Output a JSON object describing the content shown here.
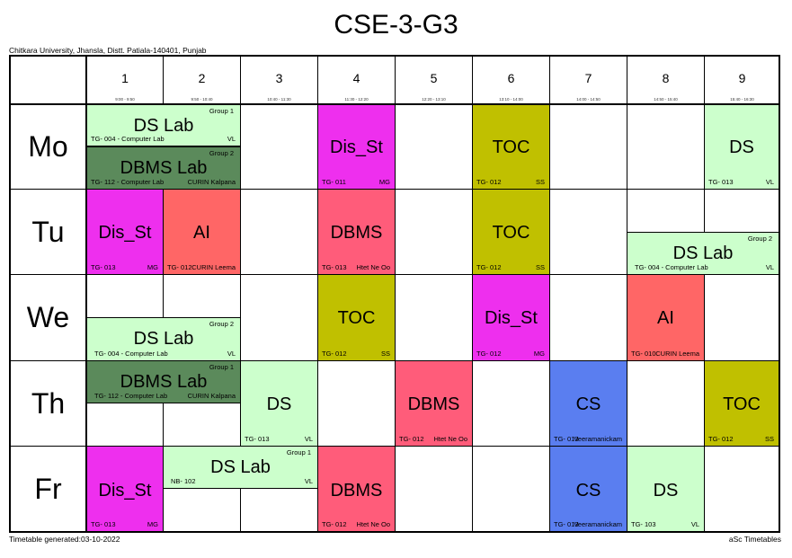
{
  "title": "CSE-3-G3",
  "school": "Chitkara University, Jhansla, Distt. Patiala-140401, Punjab",
  "footer": {
    "generated": "Timetable generated:03-10-2022",
    "brand": "aSc Timetables"
  },
  "periods": [
    {
      "num": "1",
      "time": "9:00 - 9:50"
    },
    {
      "num": "2",
      "time": "9:50 - 10:40"
    },
    {
      "num": "3",
      "time": "10:40 - 11:30"
    },
    {
      "num": "4",
      "time": "11:30 - 12:20"
    },
    {
      "num": "5",
      "time": "12:20 - 13:10"
    },
    {
      "num": "6",
      "time": "13:10 - 14:00"
    },
    {
      "num": "7",
      "time": "14:00 - 14:50"
    },
    {
      "num": "8",
      "time": "14:50 - 15:40"
    },
    {
      "num": "9",
      "time": "15:40 - 16:30"
    }
  ],
  "days": [
    "Mo",
    "Tu",
    "We",
    "Th",
    "Fr"
  ],
  "lessons": {
    "mo_dslab": {
      "subj": "DS Lab",
      "room": "TG- 004 - Computer Lab",
      "teacher": "VL",
      "group": "Group 1"
    },
    "mo_dbmslab": {
      "subj": "DBMS Lab",
      "room": "TG- 112 - Computer Lab",
      "teacher": "CURIN Kalpana",
      "group": "Group 2"
    },
    "mo_disst": {
      "subj": "Dis_St",
      "room": "TG- 011",
      "teacher": "MG"
    },
    "mo_toc": {
      "subj": "TOC",
      "room": "TG- 012",
      "teacher": "SS"
    },
    "mo_ds": {
      "subj": "DS",
      "room": "TG- 013",
      "teacher": "VL"
    },
    "tu_disst": {
      "subj": "Dis_St",
      "room": "TG- 013",
      "teacher": "MG"
    },
    "tu_ai": {
      "subj": "AI",
      "room": "TG- 012",
      "teacher": "CURIN Leema"
    },
    "tu_dbms": {
      "subj": "DBMS",
      "room": "TG- 013",
      "teacher": "Htet Ne Oo"
    },
    "tu_toc": {
      "subj": "TOC",
      "room": "TG- 012",
      "teacher": "SS"
    },
    "tu_dslab": {
      "subj": "DS Lab",
      "room": "TG- 004 - Computer Lab",
      "teacher": "VL",
      "group": "Group 2"
    },
    "we_dslab": {
      "subj": "DS Lab",
      "room": "TG- 004 - Computer Lab",
      "teacher": "VL",
      "group": "Group 2"
    },
    "we_toc": {
      "subj": "TOC",
      "room": "TG- 012",
      "teacher": "SS"
    },
    "we_disst": {
      "subj": "Dis_St",
      "room": "TG- 012",
      "teacher": "MG"
    },
    "we_ai": {
      "subj": "AI",
      "room": "TG- 010",
      "teacher": "CURIN Leema"
    },
    "th_dbmslab": {
      "subj": "DBMS Lab",
      "room": "TG- 112 - Computer Lab",
      "teacher": "CURIN Kalpana",
      "group": "Group 1"
    },
    "th_ds": {
      "subj": "DS",
      "room": "TG- 013",
      "teacher": "VL"
    },
    "th_dbms": {
      "subj": "DBMS",
      "room": "TG- 012",
      "teacher": "Htet Ne Oo"
    },
    "th_cs": {
      "subj": "CS",
      "room": "TG- 013",
      "teacher": "Veeramanickam"
    },
    "th_toc": {
      "subj": "TOC",
      "room": "TG- 012",
      "teacher": "SS"
    },
    "fr_disst": {
      "subj": "Dis_St",
      "room": "TG- 013",
      "teacher": "MG"
    },
    "fr_dslab": {
      "subj": "DS Lab",
      "room": "NB- 102",
      "teacher": "VL",
      "group": "Group 1"
    },
    "fr_dbms": {
      "subj": "DBMS",
      "room": "TG- 012",
      "teacher": "Htet Ne Oo"
    },
    "fr_cs": {
      "subj": "CS",
      "room": "TG- 013",
      "teacher": "Veeramanickam"
    },
    "fr_ds": {
      "subj": "DS",
      "room": "TG- 103",
      "teacher": "VL"
    }
  }
}
